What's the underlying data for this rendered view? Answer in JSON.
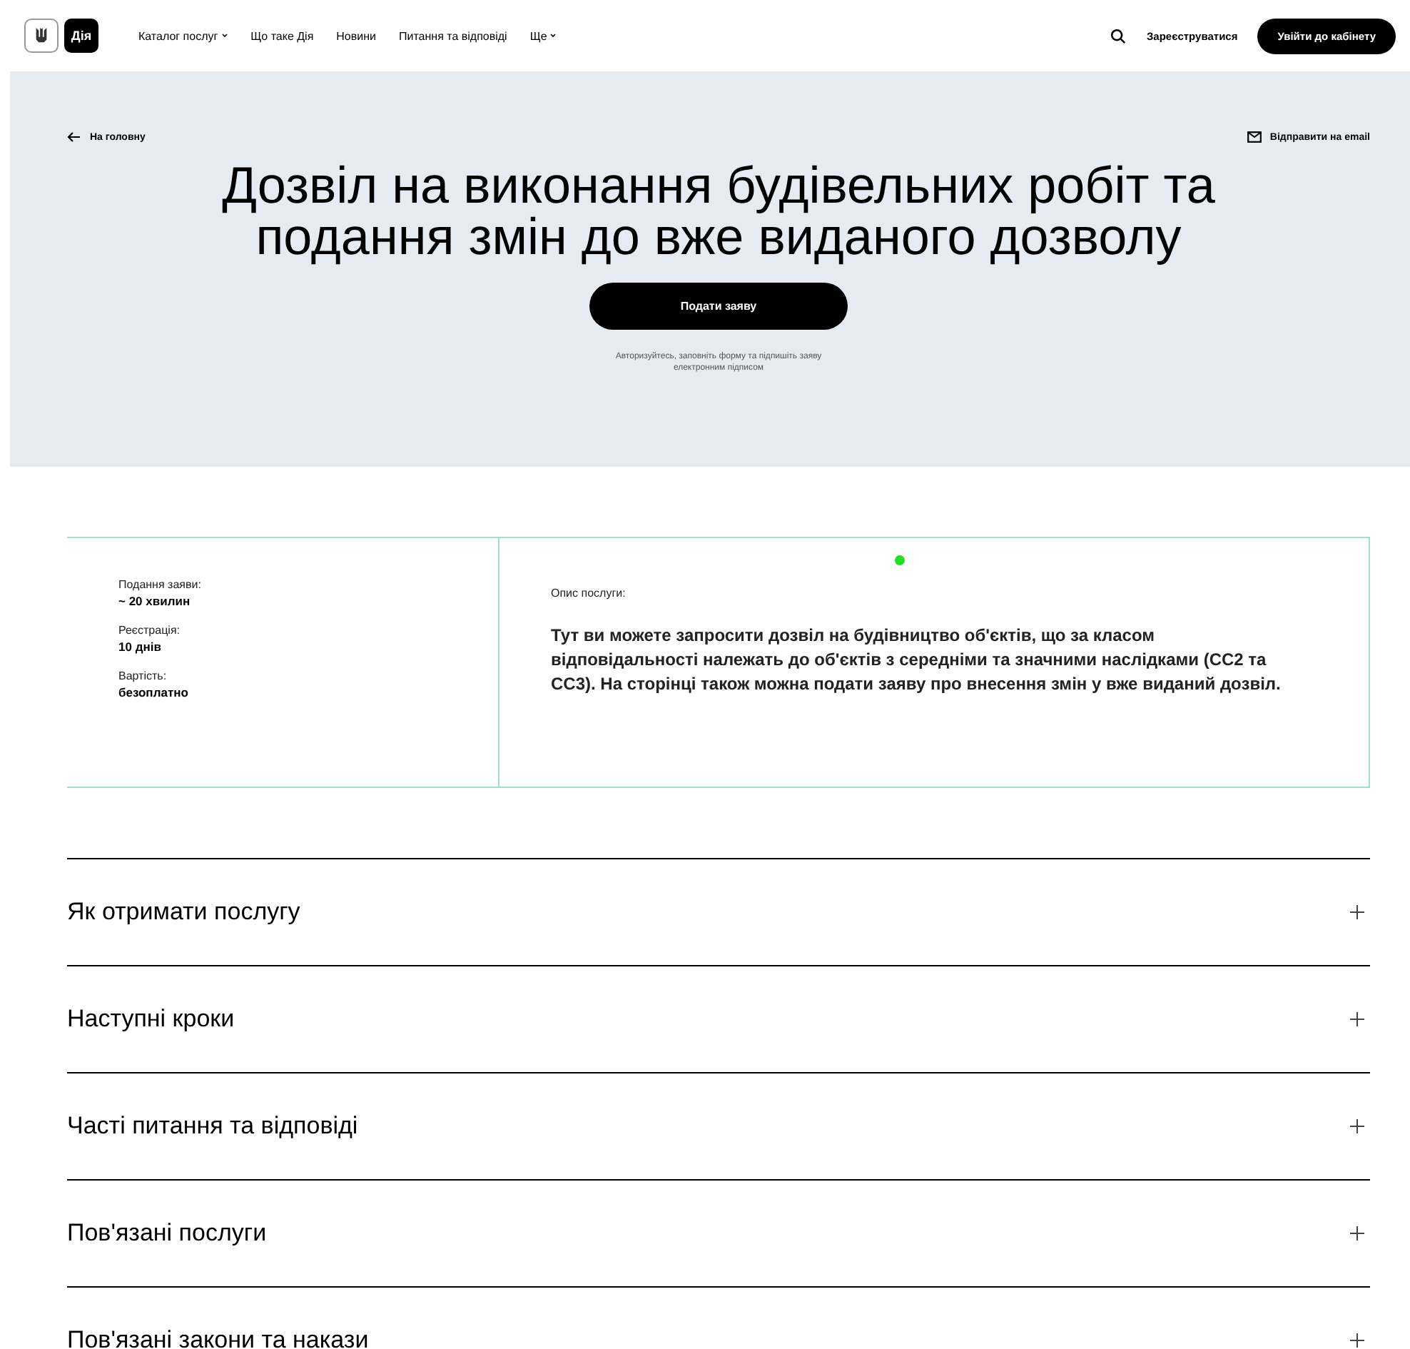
{
  "header": {
    "logo_text": "Дія",
    "nav": [
      {
        "label": "Каталог послуг",
        "dropdown": true
      },
      {
        "label": "Що таке Дія",
        "dropdown": false
      },
      {
        "label": "Новини",
        "dropdown": false
      },
      {
        "label": "Питання та відповіді",
        "dropdown": false
      },
      {
        "label": "Ще",
        "dropdown": true
      }
    ],
    "register": "Зареєструватися",
    "login": "Увійти до кабінету"
  },
  "hero": {
    "back": "На головну",
    "email": "Відправити на email",
    "title": "Дозвіл на виконання будівельних робіт та подання змін до вже виданого дозволу",
    "apply": "Подати заяву",
    "hint": "Авторизуйтесь, заповніть форму та підпишіть заяву електронним підписом"
  },
  "info": {
    "facts": [
      {
        "label": "Подання заяви:",
        "value": "~ 20 хвилин"
      },
      {
        "label": "Реєстрація:",
        "value": "10 днів"
      },
      {
        "label": "Вартість:",
        "value": "безоплатно"
      }
    ],
    "description_label": "Опис послуги:",
    "description": "Тут ви можете запросити дозвіл на будівництво об'єктів, що за класом відповідальності належать до об'єктів з середніми та значними наслідками (СС2 та СС3). На сторінці також можна подати заяву про внесення змін у вже виданий дозвіл."
  },
  "sections": [
    {
      "title": "Як отримати послугу",
      "expanded": false
    },
    {
      "title": "Наступні кроки",
      "expanded": false
    },
    {
      "title": "Часті питання та відповіді",
      "expanded": false
    },
    {
      "title": "Пов'язані послуги",
      "expanded": false
    },
    {
      "title": "Пов'язані закони та накази",
      "expanded": false
    }
  ]
}
